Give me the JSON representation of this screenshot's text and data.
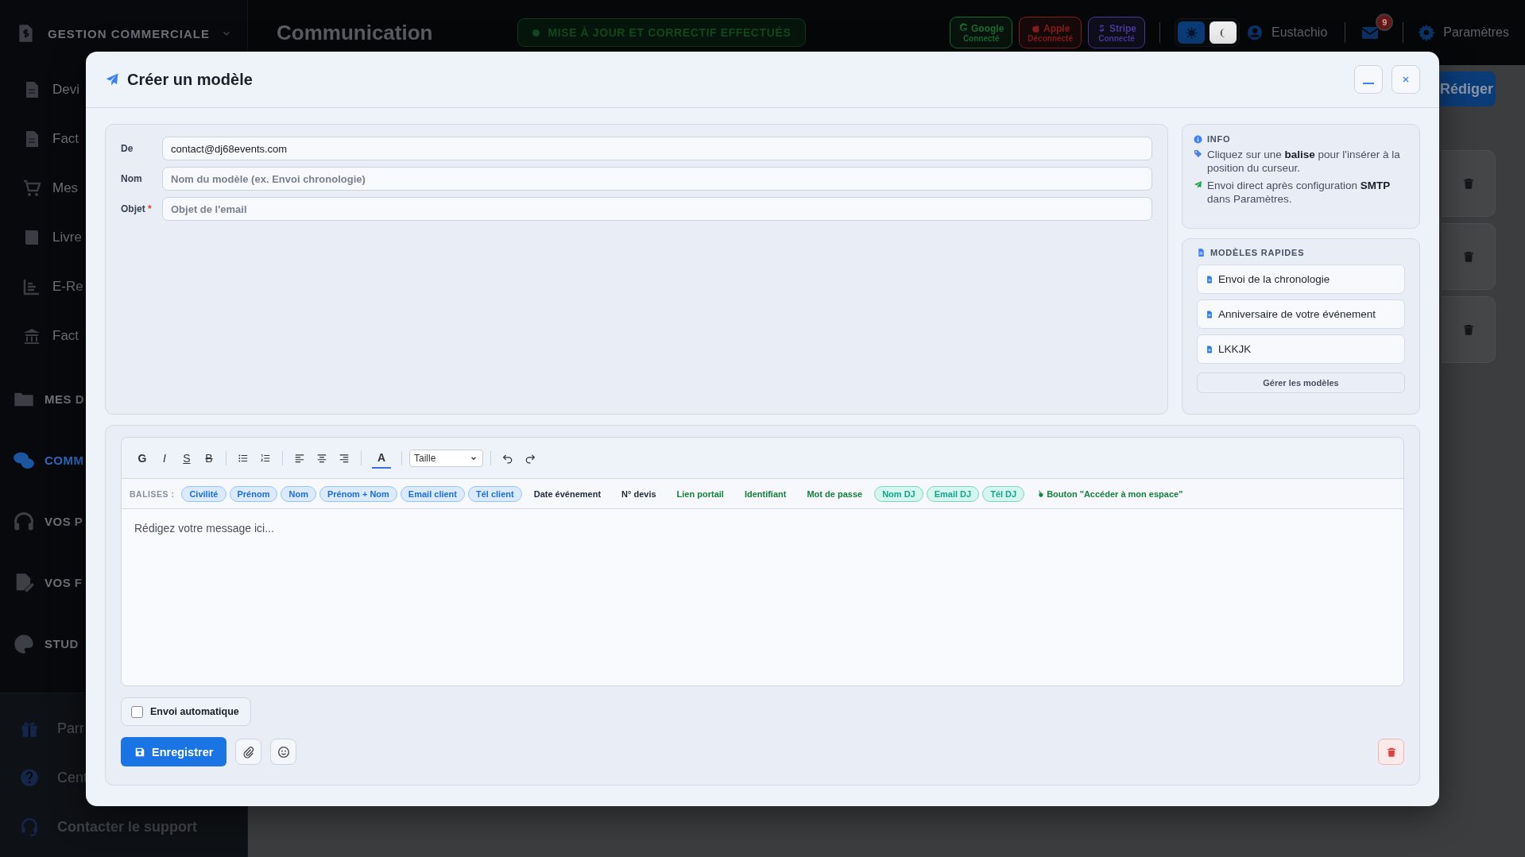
{
  "sidebar": {
    "groups": [
      {
        "title": "GESTION COMMERCIALE",
        "selected": false,
        "children": [
          {
            "label": "Devi",
            "selected": false
          },
          {
            "label": "Fact",
            "selected": false
          },
          {
            "label": "Mes",
            "selected": false
          },
          {
            "label": "Livre",
            "selected": false
          },
          {
            "label": "E-Re",
            "selected": false
          },
          {
            "label": "Fact",
            "selected": false
          }
        ]
      },
      {
        "title": "MES D",
        "selected": false
      },
      {
        "title": "COMM",
        "selected": true
      },
      {
        "title": "VOS P",
        "selected": false
      },
      {
        "title": "VOS F",
        "selected": false
      },
      {
        "title": "STUD",
        "selected": false
      }
    ],
    "footer_links": [
      {
        "label": "Parr"
      },
      {
        "label": "Cent"
      },
      {
        "label": "Contacter le support"
      }
    ]
  },
  "header": {
    "title": "Communication",
    "status": "MISE À JOUR ET CORRECTIF EFFECTUÉS",
    "integrations": [
      {
        "name": "Google",
        "state": "Connecté",
        "color": "#1c6a32"
      },
      {
        "name": "Apple",
        "state": "Déconnecté",
        "color": "#8a1d1d"
      },
      {
        "name": "Stripe",
        "state": "Connecté",
        "color": "#4b3a9a"
      }
    ],
    "theme_modes": [
      {
        "selected": true
      },
      {
        "selected": false
      }
    ],
    "user": "Eustachio",
    "mail_badge": "9",
    "settings": "Paramètres"
  },
  "page": {
    "compose_button": "Rédiger"
  },
  "modal": {
    "title": "Créer un modèle",
    "fields": [
      {
        "label": "De",
        "value": "contact@dj68events.com"
      },
      {
        "label": "Nom",
        "placeholder": "Nom du modèle (ex. Envoi chronologie)"
      },
      {
        "label": "Objet",
        "required_mark": "*",
        "placeholder": "Objet de l'email"
      }
    ],
    "info": {
      "title": "INFO",
      "lines": [
        {
          "kind": "tag",
          "text": "Cliquez sur une **balise** pour l'insérer à la position du curseur."
        },
        {
          "kind": "send",
          "text": "Envoi direct après configuration **SMTP** dans Paramètres."
        }
      ]
    },
    "quick_templates": {
      "title": "MODÈLES RAPIDES",
      "items": [
        "Envoi de la chronologie",
        "Anniversaire de votre événement",
        "LKKJK"
      ],
      "manage_button": "Gérer les modèles"
    },
    "editor": {
      "format_buttons": [
        {
          "label": "G",
          "kind": "bold"
        },
        {
          "label": "I",
          "kind": "italic"
        },
        {
          "label": "S",
          "kind": "underline"
        },
        {
          "label": "B",
          "kind": "strike"
        }
      ],
      "color_button": "A",
      "size_select": "Taille",
      "tags_label": "BALISES :",
      "tags": [
        {
          "label": "Civilité",
          "kind": "client"
        },
        {
          "label": "Prénom",
          "kind": "client"
        },
        {
          "label": "Nom",
          "kind": "client"
        },
        {
          "label": "Prénom + Nom",
          "kind": "client"
        },
        {
          "label": "Email client",
          "kind": "client"
        },
        {
          "label": "Tél client",
          "kind": "client"
        },
        {
          "label": "Date événement",
          "kind": "event"
        },
        {
          "label": "N° devis",
          "kind": "event"
        },
        {
          "label": "Lien portail",
          "kind": "portal"
        },
        {
          "label": "Identifiant",
          "kind": "portal"
        },
        {
          "label": "Mot de passe",
          "kind": "portal"
        },
        {
          "label": "Nom DJ",
          "kind": "dj"
        },
        {
          "label": "Email DJ",
          "kind": "dj"
        },
        {
          "label": "Tél DJ",
          "kind": "dj"
        },
        {
          "label": "Bouton \"Accéder à mon espace\"",
          "kind": "button"
        }
      ],
      "placeholder": "Rédigez votre message ici..."
    },
    "auto_send": {
      "label": "Envoi automatique",
      "checked": false
    },
    "save_button": "Enregistrer"
  }
}
